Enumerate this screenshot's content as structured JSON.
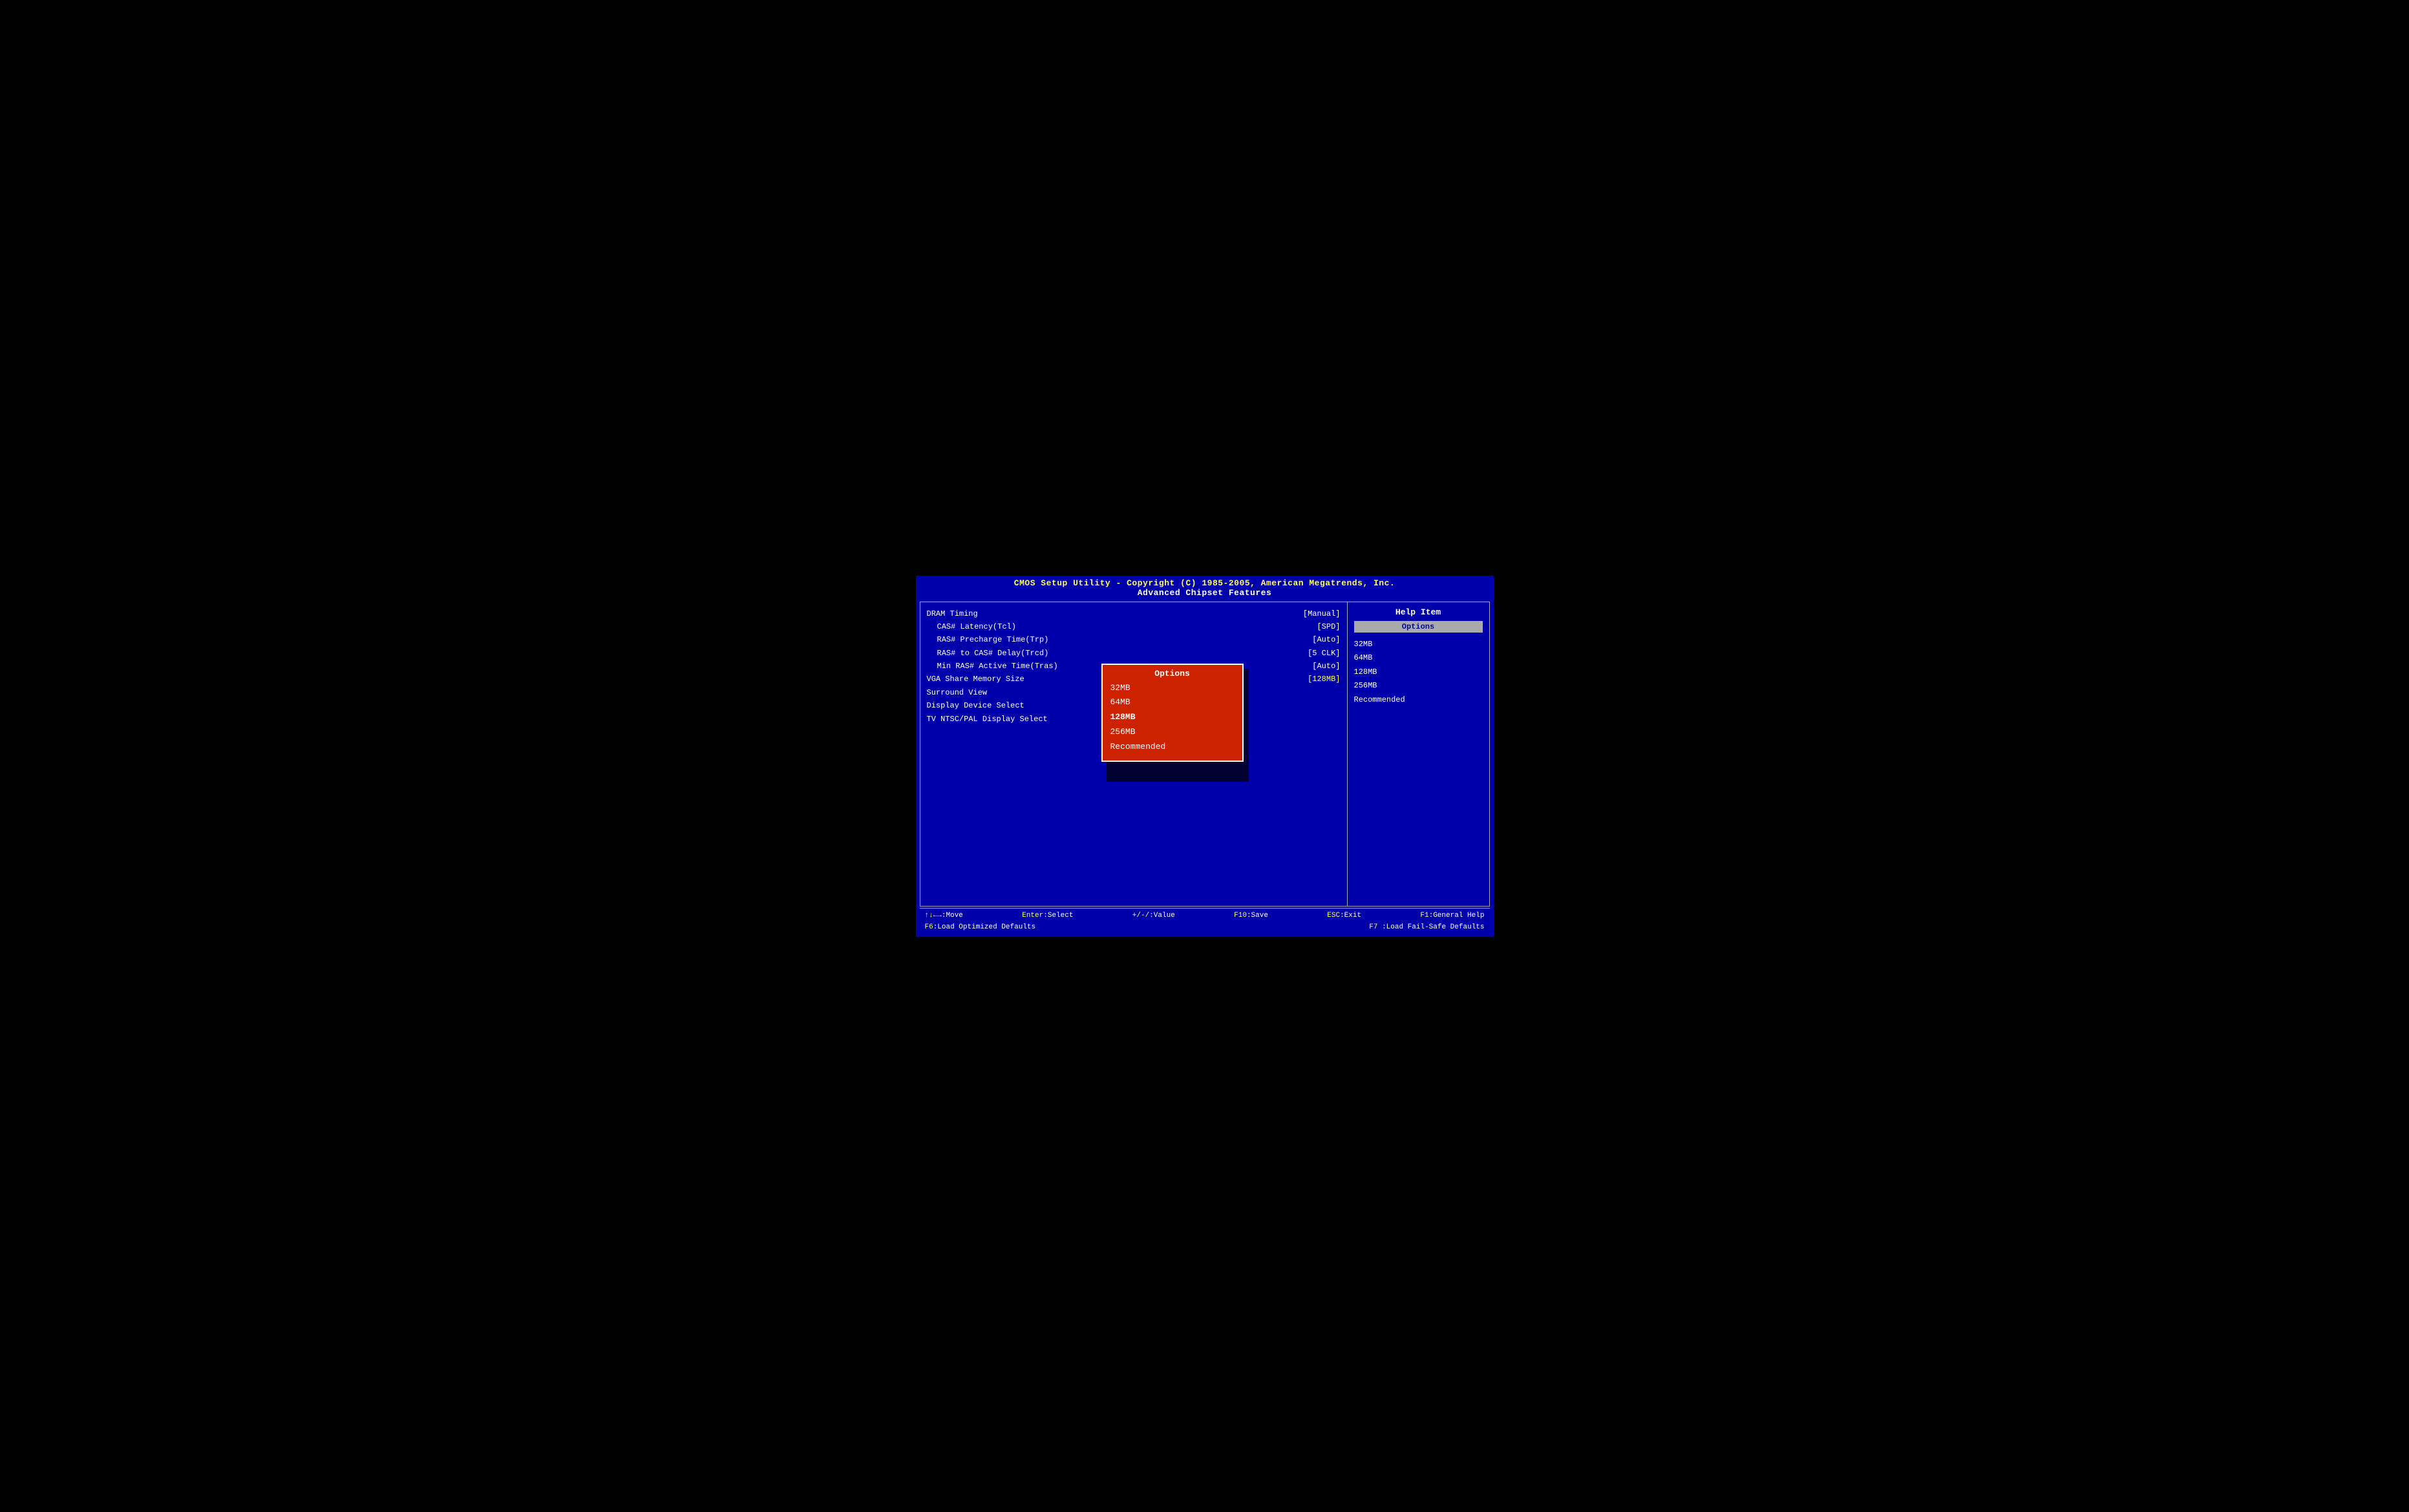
{
  "header": {
    "title": "CMOS Setup Utility - Copyright (C) 1985-2005, American Megatrends, Inc.",
    "subtitle": "Advanced Chipset Features"
  },
  "menu": {
    "items": [
      {
        "label": "DRAM Timing",
        "value": "[Manual]",
        "sub": false
      },
      {
        "label": "CAS# Latency(Tcl)",
        "value": "[SPD]",
        "sub": true
      },
      {
        "label": "RAS# Precharge Time(Trp)",
        "value": "[Auto]",
        "sub": true
      },
      {
        "label": "RAS# to CAS# Delay(Trcd)",
        "value": "[5 CLK]",
        "sub": true
      },
      {
        "label": "Min RAS# Active Time(Tras)",
        "value": "[Auto]",
        "sub": true
      },
      {
        "label": "VGA Share Memory Size",
        "value": "[128MB]",
        "sub": false,
        "selected": true
      },
      {
        "label": "Surround View",
        "value": "",
        "sub": false
      },
      {
        "label": "Display Device Select",
        "value": "",
        "sub": false
      },
      {
        "label": "TV NTSC/PAL Display Select",
        "value": "",
        "sub": false
      }
    ]
  },
  "help": {
    "title": "Help Item",
    "options_label": "Options",
    "items": [
      "32MB",
      "64MB",
      "128MB",
      "256MB",
      "Recommended"
    ]
  },
  "popup": {
    "title": "Options",
    "items": [
      {
        "label": "32MB",
        "highlighted": false
      },
      {
        "label": "64MB",
        "highlighted": false
      },
      {
        "label": "128MB",
        "highlighted": true
      },
      {
        "label": "256MB",
        "highlighted": false
      },
      {
        "label": "Recommended",
        "highlighted": false
      }
    ]
  },
  "footer": {
    "row1": [
      {
        "key": "↑↓←→",
        "desc": ":Move"
      },
      {
        "key": "Enter",
        "desc": ":Select"
      },
      {
        "key": "+/-/:",
        "desc": "Value"
      },
      {
        "key": "F10",
        "desc": ":Save"
      },
      {
        "key": "ESC",
        "desc": ":Exit"
      },
      {
        "key": "F1",
        "desc": ":General Help"
      }
    ],
    "row2": [
      {
        "key": "F6",
        "desc": ":Load Optimized Defaults"
      },
      {
        "key": "F7",
        "desc": " :Load Fail-Safe Defaults"
      }
    ]
  }
}
